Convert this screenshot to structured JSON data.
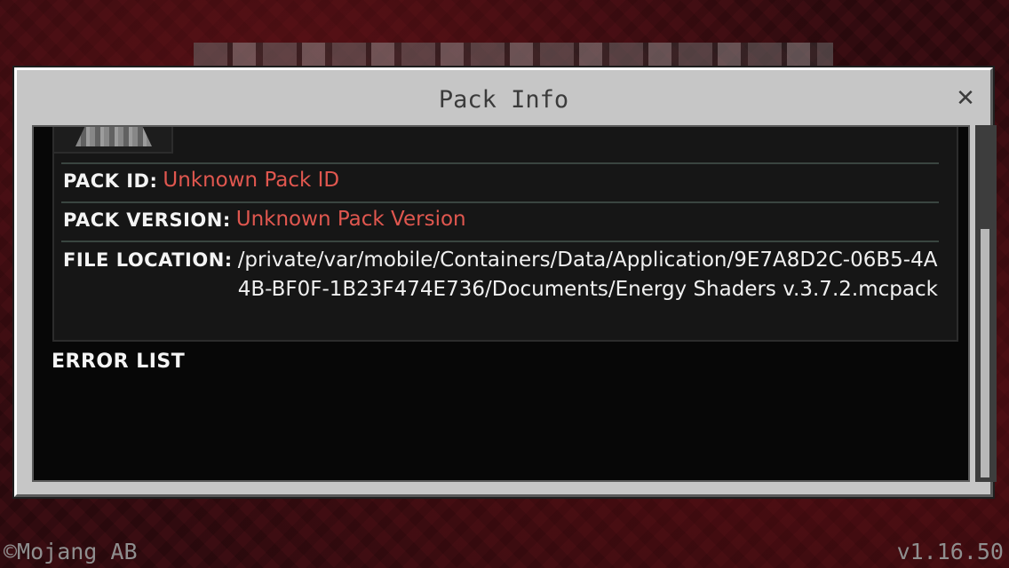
{
  "dialog": {
    "title": "Pack Info",
    "close_icon": "close-icon"
  },
  "pack": {
    "icon": "pack-thumbnail",
    "rows": [
      {
        "label": "PACK ID:",
        "value": "Unknown Pack ID",
        "value_color": "#e0574f"
      },
      {
        "label": "PACK VERSION:",
        "value": "Unknown Pack Version",
        "value_color": "#e0574f"
      },
      {
        "label": "FILE LOCATION:",
        "value": "/private/var/mobile/Containers/Data/Application/9E7A8D2C-06B5-4A4B-BF0F-1B23F474E736/Documents/Energy Shaders v.3.7.2.mcpack",
        "value_color": "#f0f0f0"
      }
    ]
  },
  "error_list": {
    "title": "ERROR LIST"
  },
  "scroll": {
    "position_fraction": 0.29
  },
  "footer": {
    "copyright": "©Mojang AB",
    "version": "v1.16.50"
  }
}
